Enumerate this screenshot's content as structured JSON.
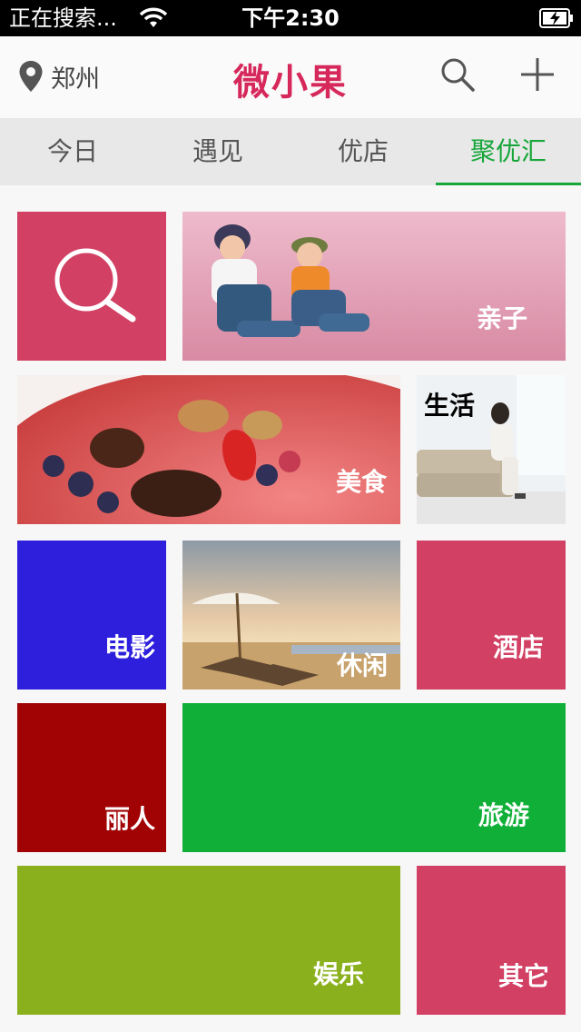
{
  "status": {
    "carrier": "正在搜索...",
    "time": "下午2:30"
  },
  "header": {
    "location": "郑州",
    "title": "微小果"
  },
  "tabs": [
    "今日",
    "遇见",
    "优店",
    "聚优汇"
  ],
  "tiles": {
    "search": {
      "color": "#d24064"
    },
    "family": {
      "label": "亲子"
    },
    "food": {
      "label": "美食"
    },
    "life": {
      "label": "生活"
    },
    "movie": {
      "label": "电影",
      "color": "#2e1fdd"
    },
    "leisure": {
      "label": "休闲"
    },
    "hotel": {
      "label": "酒店",
      "color": "#d24064"
    },
    "beauty": {
      "label": "丽人",
      "color": "#a10204"
    },
    "travel": {
      "label": "旅游",
      "color": "#10b038"
    },
    "entertainment": {
      "label": "娱乐",
      "color": "#8ab01e"
    },
    "others": {
      "label": "其它",
      "color": "#d24064"
    }
  }
}
